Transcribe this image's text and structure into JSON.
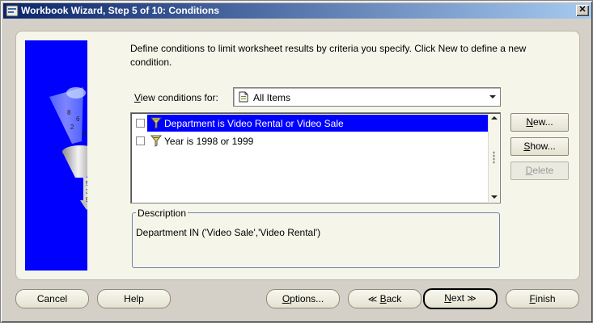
{
  "window": {
    "title": "Workbook Wizard, Step 5 of 10: Conditions",
    "close_label": "✕"
  },
  "intro": "Define conditions to limit worksheet results by criteria you specify. Click New to define a new condition.",
  "view": {
    "label_prefix": "V",
    "label_rest": "iew conditions for:",
    "selected": "All Items"
  },
  "conditions": [
    {
      "label": "Department is Video Rental or Video Sale",
      "selected": true,
      "checked": false
    },
    {
      "label": "Year is 1998 or 1999",
      "selected": false,
      "checked": false
    }
  ],
  "side_buttons": {
    "new": {
      "u": "N",
      "rest": "ew..."
    },
    "show": {
      "u": "S",
      "rest": "how..."
    },
    "delete": {
      "u": "D",
      "rest": "elete"
    }
  },
  "description": {
    "legend": "Description",
    "text": "Department IN ('Video Sale','Video Rental')"
  },
  "footer": {
    "cancel": "Cancel",
    "help": "Help",
    "options": {
      "u": "O",
      "rest": "ptions..."
    },
    "back": {
      "chev": "≪",
      "u": "B",
      "rest": "ack"
    },
    "next": {
      "u": "N",
      "rest": "ext",
      "chev": "≫"
    },
    "finish": {
      "u": "F",
      "rest": "inish"
    }
  },
  "colors": {
    "accent": "#0000ff",
    "title_start": "#0a246a",
    "title_end": "#a6caf0",
    "panel": "#f6f5ea"
  },
  "icons": [
    "wizard-app-icon",
    "funnel-icon",
    "document-icon",
    "chevron-left-icon",
    "chevron-right-icon"
  ]
}
